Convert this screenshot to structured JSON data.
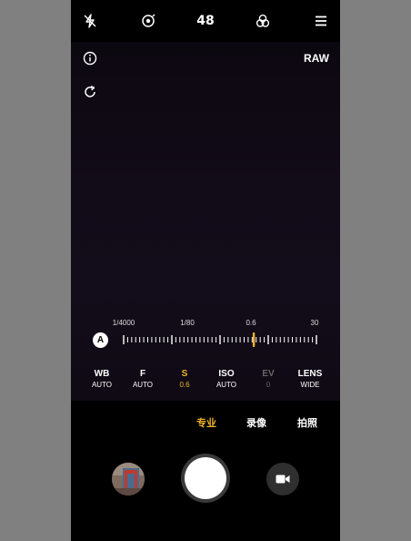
{
  "top_bar": {
    "icons": [
      "flash-off-icon",
      "live-lens-icon",
      "filter-icon",
      "menu-icon"
    ],
    "megapixels": "48"
  },
  "viewfinder": {
    "raw": "RAW",
    "left_icons": [
      "info-icon",
      "reset-icon"
    ]
  },
  "shutter_scale": {
    "auto": "A",
    "labels": [
      "1/4000",
      "1/80",
      "0.6",
      "30"
    ],
    "selected_value": "0.6",
    "selected_position": 0.675
  },
  "params": [
    {
      "name": "WB",
      "value": "AUTO"
    },
    {
      "name": "F",
      "value": "AUTO"
    },
    {
      "name": "S",
      "value": "0.6"
    },
    {
      "name": "ISO",
      "value": "AUTO"
    },
    {
      "name": "EV",
      "value": "0"
    },
    {
      "name": "LENS",
      "value": "WIDE"
    }
  ],
  "modes": {
    "pro": "专业",
    "video": "录像",
    "photo": "拍照",
    "active": "pro"
  },
  "colors": {
    "accent": "#f0b429",
    "background": "#000000",
    "disabled": "#666666"
  }
}
